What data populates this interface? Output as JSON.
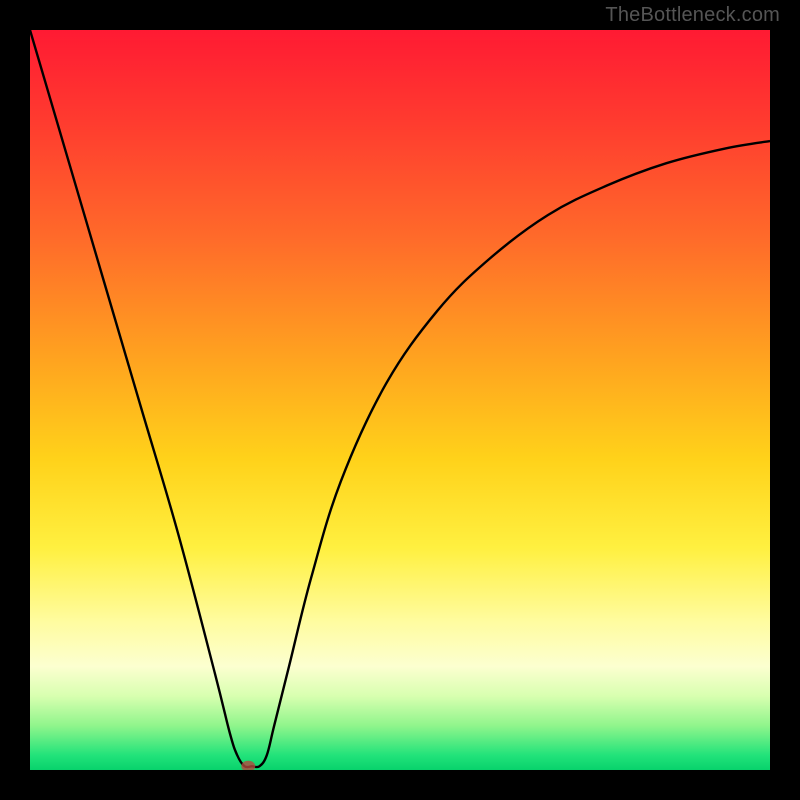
{
  "watermark": "TheBottleneck.com",
  "chart_data": {
    "type": "line",
    "title": "",
    "xlabel": "",
    "ylabel": "",
    "xlim": [
      0,
      100
    ],
    "ylim": [
      0,
      100
    ],
    "grid": false,
    "background": "rainbow-vertical-gradient",
    "series": [
      {
        "name": "bottleneck-curve",
        "x": [
          0,
          5,
          10,
          15,
          20,
          25,
          27,
          28,
          29,
          30,
          31,
          32,
          33,
          35,
          38,
          42,
          48,
          55,
          62,
          70,
          78,
          86,
          94,
          100
        ],
        "y": [
          100,
          83,
          66,
          49,
          32,
          13,
          5,
          2,
          0.5,
          0.5,
          0.5,
          2,
          6,
          14,
          26,
          39,
          52,
          62,
          69,
          75,
          79,
          82,
          84,
          85
        ]
      }
    ],
    "min_point": {
      "x": 29.5,
      "y": 0.5
    },
    "colors": {
      "frame": "#000000",
      "curve": "#000000",
      "min_dot": "#b6483d",
      "gradient_stops": [
        "#ff1a33",
        "#ff6a2a",
        "#ffd21a",
        "#fffca0",
        "#90f58c",
        "#08d26c"
      ]
    }
  }
}
